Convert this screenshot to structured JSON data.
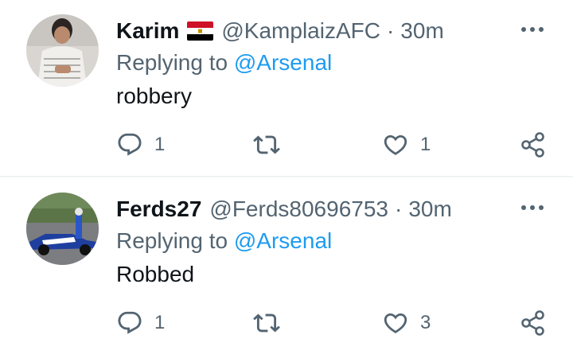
{
  "replies": [
    {
      "name": "Karim",
      "flag": "egypt-flag",
      "handle": "@KamplaizAFC",
      "separator": "·",
      "time": "30m",
      "replying_prefix": "Replying to ",
      "replying_to": "@Arsenal",
      "text": "robbery",
      "reply_count": "1",
      "retweet_count": "",
      "like_count": "1"
    },
    {
      "name": "Ferds27",
      "handle": "@Ferds80696753",
      "separator": "·",
      "time": "30m",
      "replying_prefix": "Replying to ",
      "replying_to": "@Arsenal",
      "text": "Robbed",
      "reply_count": "1",
      "retweet_count": "",
      "like_count": "3"
    }
  ],
  "colors": {
    "text_primary": "#0f1419",
    "text_secondary": "#536471",
    "link": "#1d9bf0",
    "divider": "#eff3f4"
  },
  "icons": {
    "more": "more-dots-icon",
    "reply": "reply-bubble-icon",
    "retweet": "retweet-icon",
    "like": "heart-icon",
    "share": "share-icon"
  }
}
